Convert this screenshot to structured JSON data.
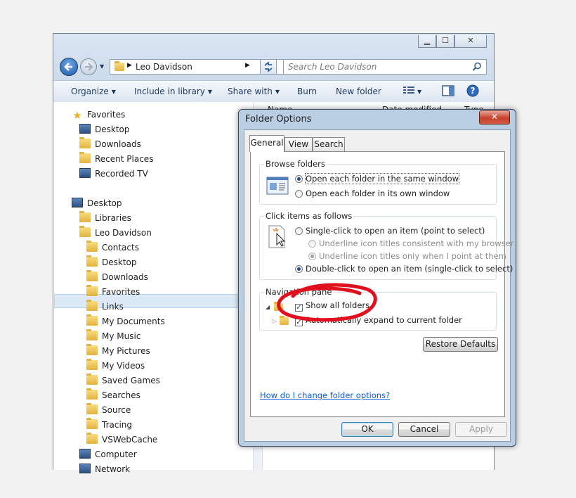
{
  "explorer": {
    "address": {
      "path": "Leo Davidson"
    },
    "search": {
      "placeholder": "Search Leo Davidson"
    },
    "toolbar": {
      "organize": "Organize",
      "include_in_library": "Include in library",
      "share_with": "Share with",
      "burn": "Burn",
      "new_folder": "New folder"
    },
    "nav": {
      "favorites": {
        "label": "Favorites",
        "items": [
          "Desktop",
          "Downloads",
          "Recent Places",
          "Recorded TV"
        ]
      },
      "desktop": "Desktop",
      "libraries": "Libraries",
      "user": "Leo Davidson",
      "user_items": [
        "Contacts",
        "Desktop",
        "Downloads",
        "Favorites",
        "Links",
        "My Documents",
        "My Music",
        "My Pictures",
        "My Videos",
        "Saved Games",
        "Searches",
        "Source",
        "Tracing",
        "VSWebCache"
      ],
      "computer": "Computer",
      "network": "Network"
    },
    "columns": {
      "name": "Name",
      "date_modified": "Date modified",
      "type": "Type"
    }
  },
  "dialog": {
    "title": "Folder Options",
    "close": "✕",
    "tabs": [
      "General",
      "View",
      "Search"
    ],
    "browse_folders": {
      "legend": "Browse folders",
      "same_window": "Open each folder in the same window",
      "own_window": "Open each folder in its own window"
    },
    "click_items": {
      "legend": "Click items as follows",
      "single_click": "Single-click to open an item (point to select)",
      "underline_browser": "Underline icon titles consistent with my browser",
      "underline_point": "Underline icon titles only when I point at them",
      "double_click": "Double-click to open an item (single-click to select)"
    },
    "navigation_pane": {
      "legend": "Navigation pane",
      "show_all_folders": "Show all folders",
      "auto_expand": "Automatically expand to current folder"
    },
    "restore_defaults": "Restore Defaults",
    "help_link": "How do I change folder options?",
    "ok": "OK",
    "cancel": "Cancel",
    "apply": "Apply",
    "annotation_color": "#e0101e"
  }
}
